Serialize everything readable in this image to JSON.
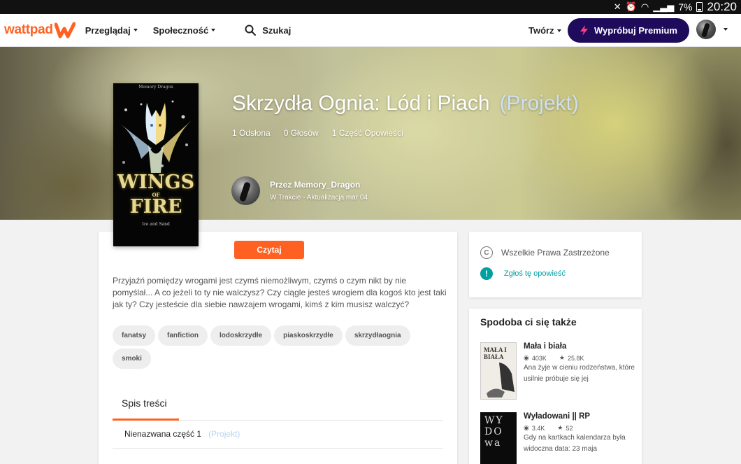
{
  "status_bar": {
    "battery": "7%",
    "time": "20:20"
  },
  "nav": {
    "logo": "wattpad",
    "browse": "Przeglądaj",
    "community": "Społeczność",
    "search_placeholder": "Szukaj",
    "create": "Twórz",
    "premium": "Wypróbuj Premium"
  },
  "story": {
    "title": "Skrzydła Ognia: Lód i Piach",
    "draft_label": "(Projekt)",
    "stats": {
      "reads": "1 Odsłona",
      "votes": "0 Głosów",
      "parts": "1 Część Opowieści"
    },
    "author": "Przez Memory_Dragon",
    "status": "W Trakcie - Aktualizacja mar 04",
    "cover": {
      "top_text": "Memory Dragon",
      "title_line1": "WINGS",
      "title_of": "OF",
      "title_line2": "FIRE",
      "subtitle": "Ice and Sand"
    },
    "read_button": "Czytaj",
    "description": "Przyjaźń pomiędzy wrogami jest czymś niemożliwym, czymś o czym nikt by nie pomyślał... A co jeżeli to ty nie walczysz? Czy ciągle jesteś wrogiem dla kogoś kto jest taki jak ty? Czy jesteście dla siebie nawzajem wrogami, kimś z kim musisz walczyć?",
    "tags": [
      "fanatsy",
      "fanfiction",
      "lodoskrzydłe",
      "piaskoskrzydłe",
      "skrzydłaognia",
      "smoki"
    ],
    "toc_title": "Spis treści",
    "parts": [
      {
        "title": "Nienazwana część 1",
        "draft": "(Projekt)"
      }
    ]
  },
  "sidebar": {
    "rights": "Wszelkie Prawa Zastrzeżone",
    "report": "Zgłoś tę opowieść",
    "recs_title": "Spodoba ci się także",
    "recs": [
      {
        "title": "Mała i biała",
        "reads": "403K",
        "votes": "25.8K",
        "desc": "Ana żyje w cieniu rodzeństwa, które usilnie próbuje się jej",
        "cover_text": "MAŁA I BIAŁA"
      },
      {
        "title": "Wyładowani || RP",
        "reads": "3.4K",
        "votes": "52",
        "desc": "Gdy na kartkach kalendarza była widoczna data: 23 maja",
        "cover_text": "WY DO wa"
      }
    ]
  },
  "colors": {
    "accent": "#ff6122",
    "premium": "#1e0b5c",
    "teal": "#00a0a0"
  }
}
